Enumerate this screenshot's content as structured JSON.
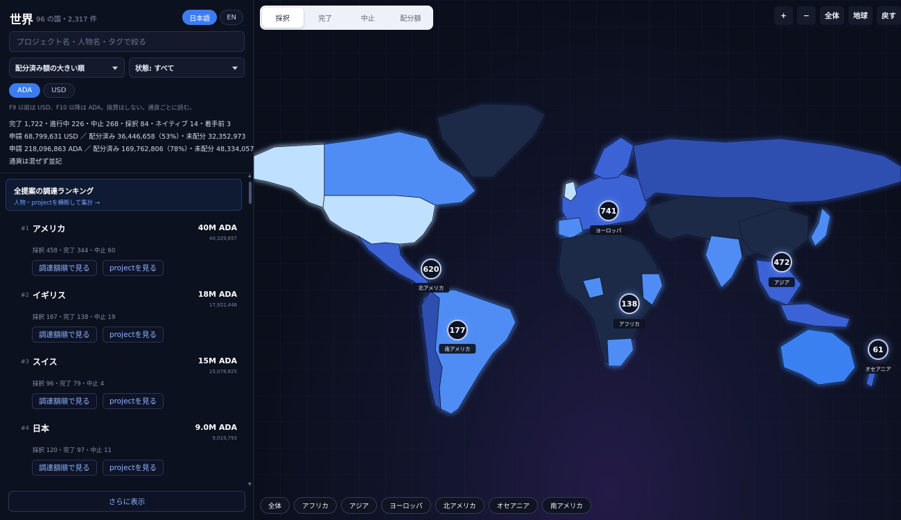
{
  "sidebar": {
    "title": "世界",
    "subtitle": "96 の国・2,317 件",
    "lang": [
      "日本語",
      "EN"
    ],
    "search_placeholder": "プロジェクト名・人物名・タグで絞る",
    "sort_select": "配分済み額の大きい順",
    "status_select": "状態: すべて",
    "currency": [
      "ADA",
      "USD"
    ],
    "note": "F9 以前は USD、F10 以降は ADA。換算はしない。通貨ごとに読む。",
    "stats": [
      "完了 1,722・進行中 226・中止 268・採択 84・ネイティブ 14・着手前 3",
      "申請 68,799,631 USD ／ 配分済み 36,446,658（53%）・未配分 32,352,973",
      "申請 218,096,863 ADA ／ 配分済み 169,762,806（78%）・未配分 48,334,057",
      "通貨は混ぜず並記"
    ],
    "ranking_card": {
      "title": "全提案の調達ランキング",
      "link": "人物・projectを横断して集計 →"
    },
    "rank_items": [
      {
        "rank": "#1",
        "name": "アメリカ",
        "amount": "40M ADA",
        "exact": "40,329,657",
        "detail": "採択 458・完了 344・中止 60",
        "btn1": "調達額順で見る",
        "btn2": "projectを見る"
      },
      {
        "rank": "#2",
        "name": "イギリス",
        "amount": "18M ADA",
        "exact": "17,922,446",
        "detail": "採択 167・完了 138・中止 19",
        "btn1": "調達額順で見る",
        "btn2": "projectを見る"
      },
      {
        "rank": "#3",
        "name": "スイス",
        "amount": "15M ADA",
        "exact": "15,078,825",
        "detail": "採択 96・完了 79・中止 4",
        "btn1": "調達額順で見る",
        "btn2": "projectを見る"
      },
      {
        "rank": "#4",
        "name": "日本",
        "amount": "9.0M ADA",
        "exact": "9,019,793",
        "detail": "採択 120・完了 97・中止 11",
        "btn1": "調達額順で見る",
        "btn2": "projectを見る"
      }
    ],
    "more_label": "さらに表示"
  },
  "map": {
    "tabs": [
      "採択",
      "完了",
      "中止",
      "配分額"
    ],
    "controls": [
      "+",
      "−",
      "全体",
      "地球",
      "戻す"
    ],
    "regions": [
      "全体",
      "アフリカ",
      "アジア",
      "ヨーロッパ",
      "北アメリカ",
      "オセアニア",
      "南アメリカ"
    ],
    "clusters": [
      {
        "count": "741",
        "label": "ヨーロッパ"
      },
      {
        "count": "620",
        "label": "北アメリカ"
      },
      {
        "count": "472",
        "label": "アジア"
      },
      {
        "count": "138",
        "label": "アフリカ"
      },
      {
        "count": "177",
        "label": "南アメリカ"
      },
      {
        "count": "61",
        "label": "オセアニア"
      }
    ],
    "colors": {
      "land_base": "#1e2947",
      "high": "#bfe0ff",
      "mid": "#4f8df5",
      "low": "#2f4fb0"
    }
  }
}
